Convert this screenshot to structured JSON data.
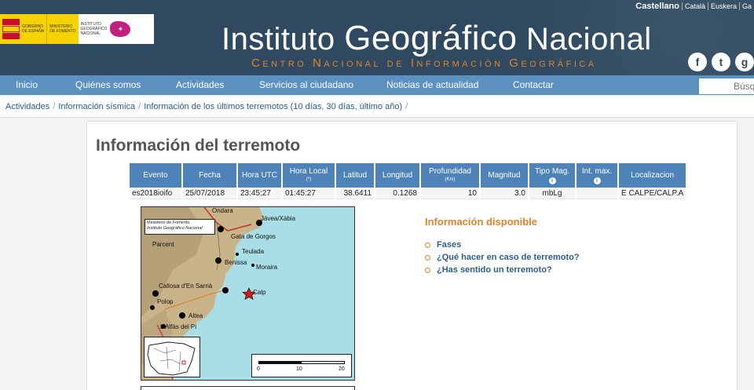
{
  "header": {
    "gov_logo_line1": "GOBIERNO",
    "gov_logo_line2": "DE ESPAÑA",
    "ministry_line1": "MINISTERIO",
    "ministry_line2": "DE FOMENTO",
    "institute_line1": "INSTITUTO",
    "institute_line2": "GEOGRÁFICO",
    "institute_line3": "NACIONAL",
    "title_part1": "Instituto ",
    "title_part2": "Geográfico",
    "title_part3": " Nacional",
    "subtitle": "Centro Nacional de Información Geográfica",
    "languages": [
      "Castellano",
      "Català",
      "Euskera",
      "Ga"
    ]
  },
  "social": [
    "f",
    "t",
    "g"
  ],
  "nav": {
    "items": [
      "Inicio",
      "Quiénes somos",
      "Actividades",
      "Servicios al ciudadano",
      "Noticias de actualidad",
      "Contactar"
    ],
    "search_placeholder": "Búsq"
  },
  "breadcrumb": [
    "Actividades",
    "Información sísmica",
    "Información de los últimos terremotos (10 días, 30 días, último año)"
  ],
  "page_title": "Información del terremoto",
  "table": {
    "headers": {
      "evento": "Evento",
      "fecha": "Fecha",
      "hora_utc": "Hora UTC",
      "hora_local": "Hora Local",
      "hora_local_sub": "(*)",
      "latitud": "Latitud",
      "longitud": "Longitud",
      "profundidad": "Profundidad",
      "profundidad_sub": "(Km)",
      "magnitud": "Magnitud",
      "tipo_mag": "Tipo Mag.",
      "int_max": "Int. max.",
      "localizacion": "Localizacion"
    },
    "row": {
      "evento": "es2018ioifo",
      "fecha": "25/07/2018",
      "hora_utc": "23:45:27",
      "hora_local": "01:45:27",
      "latitud": "38.6411",
      "longitud": "0.1268",
      "profundidad": "10",
      "magnitud": "3.0",
      "tipo_mag": "mbLg",
      "int_max": "",
      "localizacion": "E CALPE/CALP.A"
    }
  },
  "map": {
    "legend_line1": "Ministerio de Fomento",
    "legend_line2": "Instituto Geográfico Nacional",
    "places": [
      "Ondara",
      "Jávea/Xàbia",
      "Gata de Gorgos",
      "Parcent",
      "Teulada",
      "Benissa",
      "Moraira",
      "Callosa d'En Sarrià",
      "Polop",
      "Calp",
      "Altea",
      "L'Alfàs del Pi"
    ],
    "scale_ticks": [
      "0",
      "10",
      "20"
    ]
  },
  "info": {
    "title": "Información disponible",
    "links": [
      "Fases",
      "¿Qué hacer en caso de terremoto?",
      "¿Has sentido un terremoto?"
    ]
  }
}
